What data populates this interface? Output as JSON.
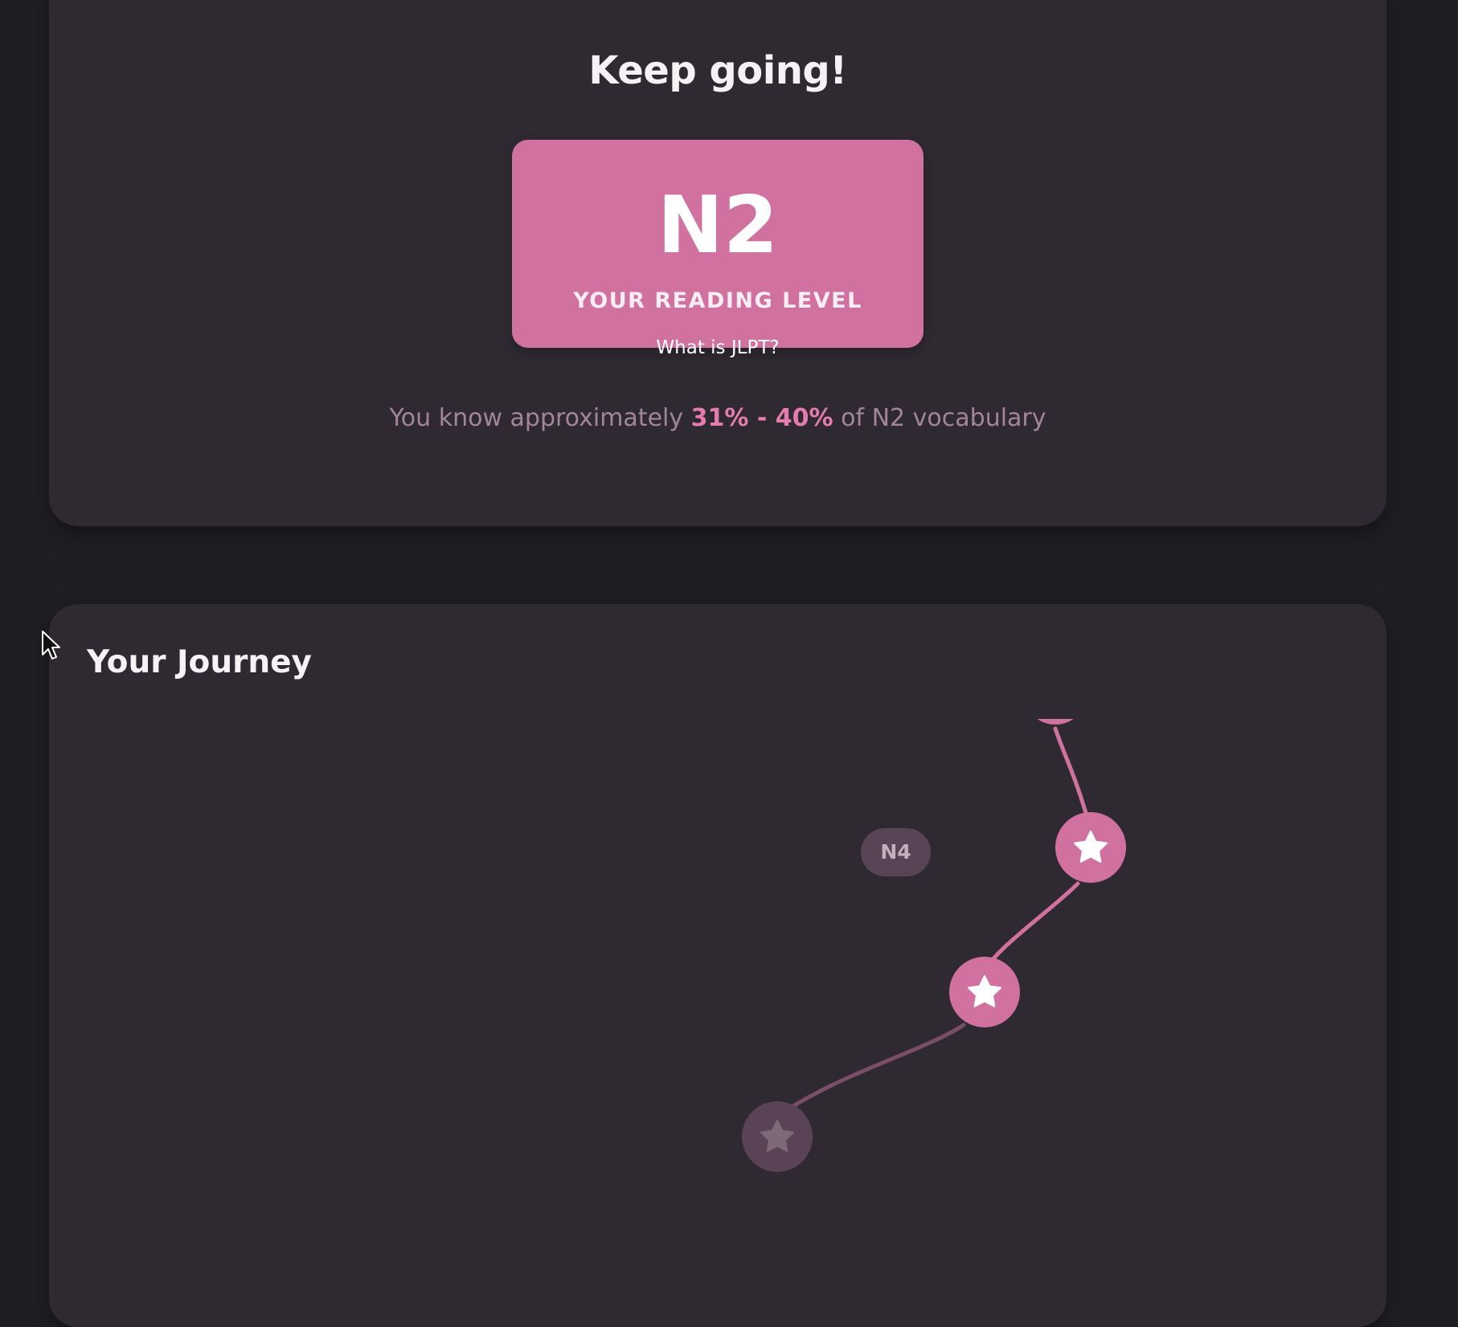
{
  "result": {
    "headline": "Keep going!",
    "level_code": "N2",
    "level_caption": "YOUR READING LEVEL",
    "jlpt_link": "What is JLPT?",
    "vocab_prefix": "You know approximately",
    "vocab_range": "31% - 40%",
    "vocab_suffix": "of N2 vocabulary"
  },
  "journey": {
    "title": "Your Journey",
    "milestones": [
      {
        "icon": "star-icon",
        "state": "completed"
      },
      {
        "icon": "star-icon",
        "state": "completed",
        "label": "N4"
      },
      {
        "icon": "star-icon",
        "state": "locked"
      }
    ]
  },
  "colors": {
    "background": "#1f1e22",
    "card": "#2f2a32",
    "accent": "#d171a0",
    "accent_text": "#e57cb0",
    "muted_text": "#a3859a",
    "locked": "#4e3a4a"
  }
}
